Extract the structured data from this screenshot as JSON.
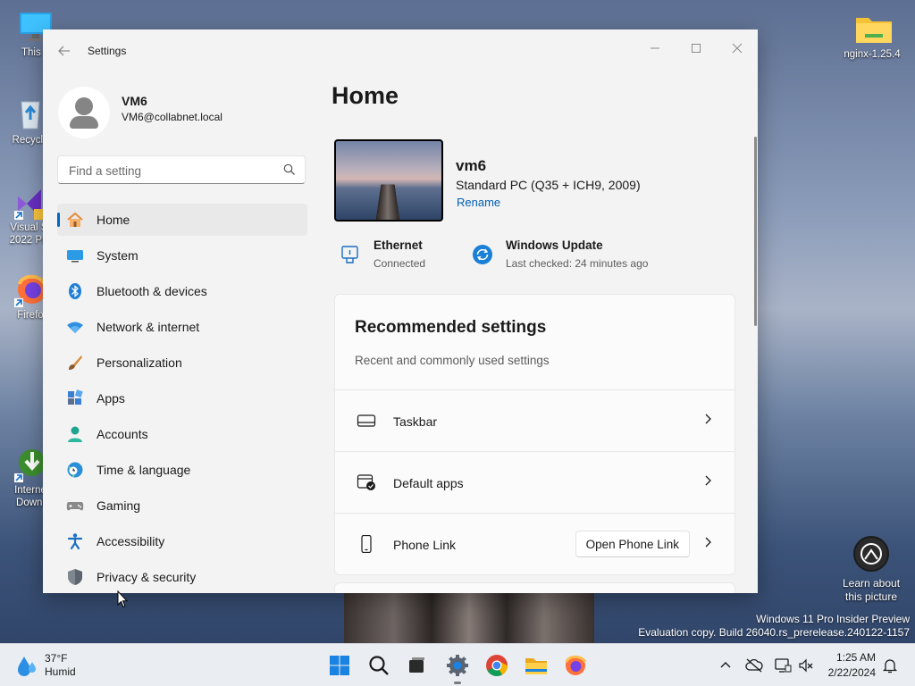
{
  "desktop": {
    "icons": [
      {
        "label": "This PC",
        "visible_label": "This F",
        "name": "this-pc"
      },
      {
        "label": "Recycle Bin",
        "visible_label": "Recycle",
        "name": "recycle-bin"
      },
      {
        "label": "Visual Studio 2022 Preview",
        "line1": "Visual St",
        "line2": "2022 Pre",
        "name": "visual-studio"
      },
      {
        "label": "Firefox",
        "visible_label": "Firefo",
        "name": "firefox"
      },
      {
        "label": "Internet Download Manager",
        "line1": "Interne",
        "line2": "Downl",
        "name": "idm"
      },
      {
        "label": "nginx-1.25.4",
        "visible_label": "nginx-1.25.4",
        "name": "nginx-folder"
      }
    ],
    "learn_about": {
      "line1": "Learn about",
      "line2": "this picture"
    },
    "watermark": {
      "line1": "Windows 11 Pro Insider Preview",
      "line2": "Evaluation copy. Build 26040.rs_prerelease.240122-1157"
    }
  },
  "window": {
    "title": "Settings",
    "controls": {
      "minimize": "—",
      "maximize": "☐",
      "close": "✕"
    }
  },
  "profile": {
    "name": "VM6",
    "email": "VM6@collabnet.local"
  },
  "search": {
    "placeholder": "Find a setting",
    "value": ""
  },
  "nav": {
    "items": [
      {
        "label": "Home",
        "icon": "home-icon",
        "active": true
      },
      {
        "label": "System",
        "icon": "system-icon"
      },
      {
        "label": "Bluetooth & devices",
        "icon": "bluetooth-icon"
      },
      {
        "label": "Network & internet",
        "icon": "network-icon"
      },
      {
        "label": "Personalization",
        "icon": "brush-icon"
      },
      {
        "label": "Apps",
        "icon": "apps-icon"
      },
      {
        "label": "Accounts",
        "icon": "accounts-icon"
      },
      {
        "label": "Time & language",
        "icon": "globe-clock-icon"
      },
      {
        "label": "Gaming",
        "icon": "gamepad-icon"
      },
      {
        "label": "Accessibility",
        "icon": "accessibility-icon"
      },
      {
        "label": "Privacy & security",
        "icon": "shield-icon"
      }
    ]
  },
  "main": {
    "title": "Home",
    "device": {
      "name": "vm6",
      "model": "Standard PC (Q35 + ICH9, 2009)",
      "rename": "Rename"
    },
    "status": {
      "ethernet": {
        "title": "Ethernet",
        "sub": "Connected"
      },
      "update": {
        "title": "Windows Update",
        "sub": "Last checked: 24 minutes ago"
      }
    },
    "recommended": {
      "title": "Recommended settings",
      "subtitle": "Recent and commonly used settings",
      "rows": [
        {
          "label": "Taskbar",
          "icon": "taskbar-icon"
        },
        {
          "label": "Default apps",
          "icon": "default-apps-icon"
        },
        {
          "label": "Phone Link",
          "icon": "phone-icon",
          "button": "Open Phone Link"
        }
      ]
    }
  },
  "taskbar": {
    "weather": {
      "temp": "37°F",
      "condition": "Humid"
    },
    "apps": [
      "start",
      "search",
      "task-view",
      "settings",
      "chrome",
      "file-explorer",
      "firefox"
    ],
    "clock": {
      "time": "1:25 AM",
      "date": "2/22/2024"
    }
  },
  "colors": {
    "accent": "#0067c0",
    "link": "#005fb8",
    "window_bg": "#f3f3f3"
  }
}
